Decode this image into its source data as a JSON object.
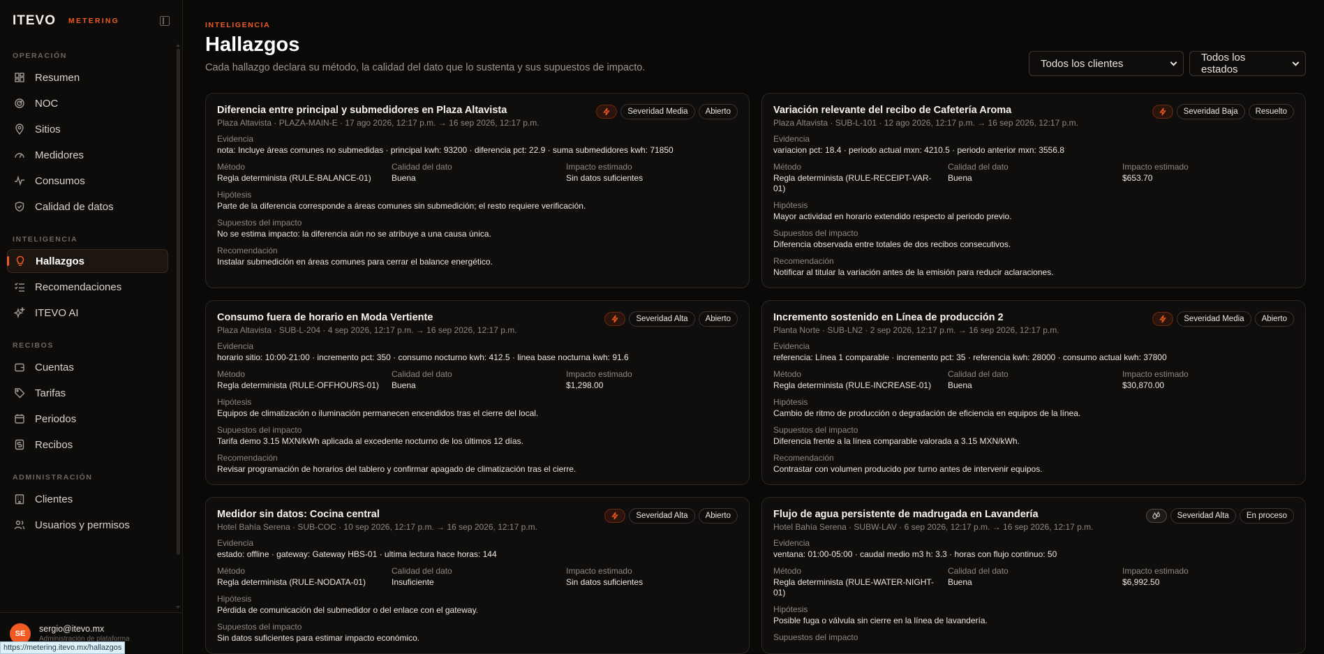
{
  "brand": {
    "logo": "ITEVO",
    "product": "METERING"
  },
  "sidebar": {
    "sections": [
      {
        "label": "OPERACIÓN",
        "items": [
          {
            "label": "Resumen",
            "icon": "dashboard-icon"
          },
          {
            "label": "NOC",
            "icon": "radar-icon"
          },
          {
            "label": "Sitios",
            "icon": "map-pin-icon"
          },
          {
            "label": "Medidores",
            "icon": "gauge-icon"
          },
          {
            "label": "Consumos",
            "icon": "activity-icon"
          },
          {
            "label": "Calidad de datos",
            "icon": "shield-check-icon"
          }
        ]
      },
      {
        "label": "INTELIGENCIA",
        "items": [
          {
            "label": "Hallazgos",
            "icon": "lightbulb-icon",
            "active": true
          },
          {
            "label": "Recomendaciones",
            "icon": "checklist-icon"
          },
          {
            "label": "ITEVO AI",
            "icon": "sparkles-icon"
          }
        ]
      },
      {
        "label": "RECIBOS",
        "items": [
          {
            "label": "Cuentas",
            "icon": "wallet-icon"
          },
          {
            "label": "Tarifas",
            "icon": "tag-icon"
          },
          {
            "label": "Periodos",
            "icon": "calendar-icon"
          },
          {
            "label": "Recibos",
            "icon": "receipt-icon"
          }
        ]
      },
      {
        "label": "ADMINISTRACIÓN",
        "items": [
          {
            "label": "Clientes",
            "icon": "building-icon"
          },
          {
            "label": "Usuarios y permisos",
            "icon": "users-icon"
          }
        ]
      }
    ],
    "user": {
      "initials": "SE",
      "email": "sergio@itevo.mx",
      "role": "Administración de plataforma"
    },
    "status_url": "https://metering.itevo.mx/hallazgos"
  },
  "header": {
    "kicker": "INTELIGENCIA",
    "title": "Hallazgos",
    "subtitle": "Cada hallazgo declara su método, la calidad del dato que lo sustenta y sus supuestos de impacto."
  },
  "filters": {
    "clients": "Todos los clientes",
    "states": "Todos los estados"
  },
  "labels": {
    "evidence": "Evidencia",
    "method": "Método",
    "quality": "Calidad del dato",
    "impact": "Impacto estimado",
    "hypothesis": "Hipótesis",
    "assumptions": "Supuestos del impacto",
    "recommendation": "Recomendación"
  },
  "findings": [
    {
      "title": "Diferencia entre principal y submedidores en Plaza Altavista",
      "meta": "Plaza Altavista · PLAZA-MAIN-E · 17 ago 2026, 12:17 p.m. → 16 sep 2026, 12:17 p.m.",
      "icon": "bolt-icon",
      "severity": "Severidad Media",
      "status": "Abierto",
      "evidence": "nota: Incluye áreas comunes no submedidas · principal kwh: 93200 · diferencia pct: 22.9 · suma submedidores kwh: 71850",
      "method": "Regla determinista (RULE-BALANCE-01)",
      "quality": "Buena",
      "impact": "Sin datos suficientes",
      "hypothesis": "Parte de la diferencia corresponde a áreas comunes sin submedición; el resto requiere verificación.",
      "assumptions": "No se estima impacto: la diferencia aún no se atribuye a una causa única.",
      "recommendation": "Instalar submedición en áreas comunes para cerrar el balance energético."
    },
    {
      "title": "Variación relevante del recibo de Cafetería Aroma",
      "meta": "Plaza Altavista · SUB-L-101 · 12 ago 2026, 12:17 p.m. → 16 sep 2026, 12:17 p.m.",
      "icon": "bolt-icon",
      "severity": "Severidad Baja",
      "status": "Resuelto",
      "evidence": "variacion pct: 18.4 · periodo actual mxn: 4210.5 · periodo anterior mxn: 3556.8",
      "method": "Regla determinista (RULE-RECEIPT-VAR-01)",
      "quality": "Buena",
      "impact": "$653.70",
      "hypothesis": "Mayor actividad en horario extendido respecto al periodo previo.",
      "assumptions": "Diferencia observada entre totales de dos recibos consecutivos.",
      "recommendation": "Notificar al titular la variación antes de la emisión para reducir aclaraciones."
    },
    {
      "title": "Consumo fuera de horario en Moda Vertiente",
      "meta": "Plaza Altavista · SUB-L-204 · 4 sep 2026, 12:17 p.m. → 16 sep 2026, 12:17 p.m.",
      "icon": "bolt-icon",
      "severity": "Severidad Alta",
      "status": "Abierto",
      "evidence": "horario sitio: 10:00-21:00 · incremento pct: 350 · consumo nocturno kwh: 412.5 · linea base nocturna kwh: 91.6",
      "method": "Regla determinista (RULE-OFFHOURS-01)",
      "quality": "Buena",
      "impact": "$1,298.00",
      "hypothesis": "Equipos de climatización o iluminación permanecen encendidos tras el cierre del local.",
      "assumptions": "Tarifa demo 3.15 MXN/kWh aplicada al excedente nocturno de los últimos 12 días.",
      "recommendation": "Revisar programación de horarios del tablero y confirmar apagado de climatización tras el cierre."
    },
    {
      "title": "Incremento sostenido en Línea de producción 2",
      "meta": "Planta Norte · SUB-LN2 · 2 sep 2026, 12:17 p.m. → 16 sep 2026, 12:17 p.m.",
      "icon": "bolt-icon",
      "severity": "Severidad Media",
      "status": "Abierto",
      "evidence": "referencia: Línea 1 comparable · incremento pct: 35 · referencia kwh: 28000 · consumo actual kwh: 37800",
      "method": "Regla determinista (RULE-INCREASE-01)",
      "quality": "Buena",
      "impact": "$30,870.00",
      "hypothesis": "Cambio de ritmo de producción o degradación de eficiencia en equipos de la línea.",
      "assumptions": "Diferencia frente a la línea comparable valorada a 3.15 MXN/kWh.",
      "recommendation": "Contrastar con volumen producido por turno antes de intervenir equipos."
    },
    {
      "title": "Medidor sin datos: Cocina central",
      "meta": "Hotel Bahía Serena · SUB-COC · 10 sep 2026, 12:17 p.m. → 16 sep 2026, 12:17 p.m.",
      "icon": "bolt-icon",
      "severity": "Severidad Alta",
      "status": "Abierto",
      "evidence": "estado: offline · gateway: Gateway HBS-01 · ultima lectura hace horas: 144",
      "method": "Regla determinista (RULE-NODATA-01)",
      "quality": "Insuficiente",
      "impact": "Sin datos suficientes",
      "hypothesis": "Pérdida de comunicación del submedidor o del enlace con el gateway.",
      "assumptions": "Sin datos suficientes para estimar impacto económico.",
      "recommendation": ""
    },
    {
      "title": "Flujo de agua persistente de madrugada en Lavandería",
      "meta": "Hotel Bahía Serena · SUBW-LAV · 6 sep 2026, 12:17 p.m. → 16 sep 2026, 12:17 p.m.",
      "icon": "droplets-icon",
      "severity": "Severidad Alta",
      "status": "En proceso",
      "evidence": "ventana: 01:00-05:00 · caudal medio m3 h: 3.3 · horas con flujo continuo: 50",
      "method": "Regla determinista (RULE-WATER-NIGHT-01)",
      "quality": "Buena",
      "impact": "$6,992.50",
      "hypothesis": "Posible fuga o válvula sin cierre en la línea de lavandería.",
      "assumptions": "",
      "recommendation": ""
    }
  ]
}
